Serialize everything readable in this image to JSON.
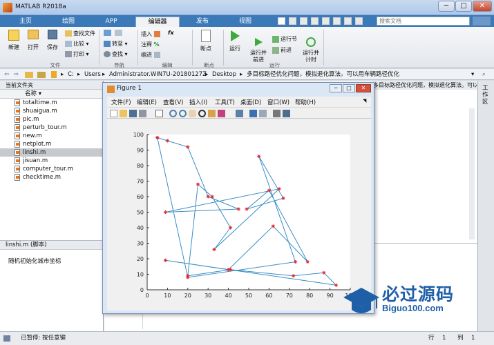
{
  "window": {
    "title": "MATLAB R2018a",
    "minimize": "─",
    "maximize": "□",
    "close": "✕"
  },
  "tabs": [
    {
      "label": "主页"
    },
    {
      "label": "绘图"
    },
    {
      "label": "APP"
    },
    {
      "label": "编辑器"
    },
    {
      "label": "发布"
    },
    {
      "label": "视图"
    }
  ],
  "search": {
    "placeholder": "搜索文档"
  },
  "ribbon": {
    "new": "新建",
    "open": "打开",
    "save": "保存",
    "find_files": "查找文件",
    "compare": "比较",
    "print": "打印",
    "file_section": "文件",
    "goto": "转至",
    "find": "查找",
    "nav_section": "导航",
    "insert": "插入",
    "comment": "注释",
    "indent": "缩进",
    "fx": "fx",
    "edit_section": "编辑",
    "breakpoints": "断点",
    "breakpoints_section": "断点",
    "run": "运行",
    "run_advance": "运行并\n前进",
    "run_section": "运行节",
    "advance": "前进",
    "run_time": "运行并\n计时",
    "run_section_label": "运行"
  },
  "address": {
    "segments": [
      "C:",
      "Users",
      "Administrator.WIN7U-20180127Z",
      "Desktop",
      "多目标路径优化问题，模拟退化算法。可以用车辆路径优化"
    ]
  },
  "left_panel": {
    "title": "当前文件夹",
    "column": "名称 ▾",
    "files": [
      {
        "name": "totaltime.m"
      },
      {
        "name": "shuaigua.m"
      },
      {
        "name": "pic.m"
      },
      {
        "name": "perturb_tour.m"
      },
      {
        "name": "new.m"
      },
      {
        "name": "netplot.m"
      },
      {
        "name": "linshi.m"
      },
      {
        "name": "jisuan.m"
      },
      {
        "name": "computer_tour.m"
      },
      {
        "name": "checktime.m"
      }
    ],
    "detail_title": "linshi.m  (脚本)",
    "detail_text": "随机初始化城市坐标"
  },
  "editor_tab": "多目标路径优化问题，模拟退化算法。可以用车辆路径优化",
  "right_strip": "工作区",
  "status": {
    "left": "已暂停: 按任意键",
    "line_label": "行",
    "line": "1",
    "col_label": "列",
    "col": "1"
  },
  "figure": {
    "title": "Figure 1",
    "menus": [
      "文件(F)",
      "编辑(E)",
      "查看(V)",
      "插入(I)",
      "工具(T)",
      "桌面(D)",
      "窗口(W)",
      "帮助(H)"
    ]
  },
  "watermark": {
    "cn": "必过源码",
    "en": "Biguo100.com"
  },
  "colors": {
    "line": "#3a8dc5",
    "marker": "#e8262a",
    "accent": "#3b79b9"
  },
  "chart_data": {
    "type": "line",
    "xlim": [
      0,
      100
    ],
    "ylim": [
      0,
      100
    ],
    "xticks": [
      "0",
      "10",
      "20",
      "30",
      "40",
      "50",
      "60",
      "70",
      "80",
      "90",
      "100"
    ],
    "yticks": [
      "0",
      "10",
      "20",
      "30",
      "40",
      "50",
      "60",
      "70",
      "80",
      "90",
      "100"
    ],
    "grid": false,
    "series": [
      {
        "x": [
          5,
          10,
          20,
          30,
          45,
          9,
          65,
          33,
          41,
          32,
          25,
          20,
          41,
          72,
          87,
          93,
          9,
          40,
          62,
          79,
          60,
          49,
          67,
          55,
          73,
          20,
          5
        ],
        "y": [
          98,
          96,
          92,
          60,
          52,
          50,
          65,
          26,
          40,
          60,
          68,
          9,
          13,
          9,
          11,
          3,
          19,
          13,
          41,
          18,
          64,
          52,
          59,
          86,
          18,
          8,
          98
        ]
      }
    ]
  }
}
